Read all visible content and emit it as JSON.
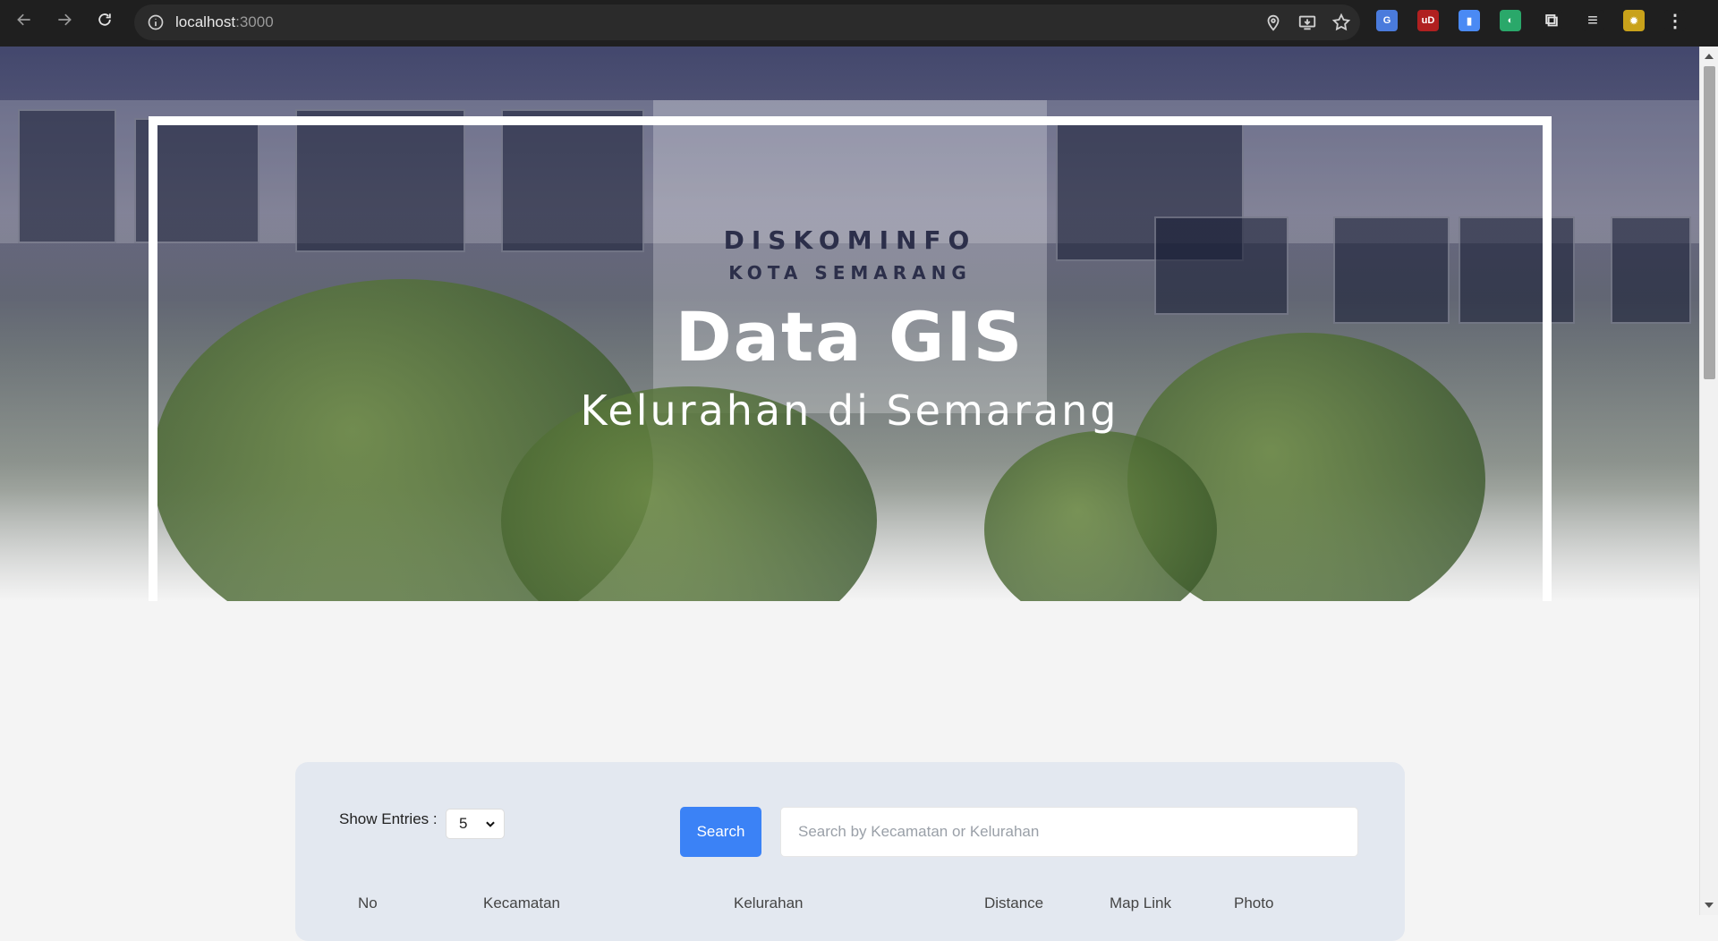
{
  "browser": {
    "url_host": "localhost",
    "url_port": ":3000",
    "extensions": [
      {
        "name": "google-translate-icon",
        "color": "#4a7bdc",
        "glyph": "G"
      },
      {
        "name": "ublock-icon",
        "color": "#b02020",
        "glyph": "uD"
      },
      {
        "name": "docs-icon",
        "color": "#4a8af4",
        "glyph": "▮"
      },
      {
        "name": "edge-extension-icon",
        "color": "#2aa86a",
        "glyph": "◐"
      },
      {
        "name": "extensions-puzzle-icon",
        "color": "#1f1f1f",
        "glyph": "⧉"
      },
      {
        "name": "media-control-icon",
        "color": "#1f1f1f",
        "glyph": "≡"
      },
      {
        "name": "profile-avatar-icon",
        "color": "#c9a21a",
        "glyph": "✹"
      },
      {
        "name": "menu-kebab-icon",
        "color": "#1f1f1f",
        "glyph": "⋮"
      }
    ]
  },
  "hero": {
    "sign_line1": "DISKOMINFO",
    "sign_line2": "KOTA SEMARANG",
    "title": "Data GIS",
    "subtitle": "Kelurahan di Semarang"
  },
  "controls": {
    "entries_label": "Show Entries :",
    "entries_value": "5",
    "search_button": "Search",
    "search_placeholder": "Search by Kecamatan or Kelurahan"
  },
  "table": {
    "headers": [
      "No",
      "Kecamatan",
      "Kelurahan",
      "Distance",
      "Map Link",
      "Photo"
    ]
  }
}
